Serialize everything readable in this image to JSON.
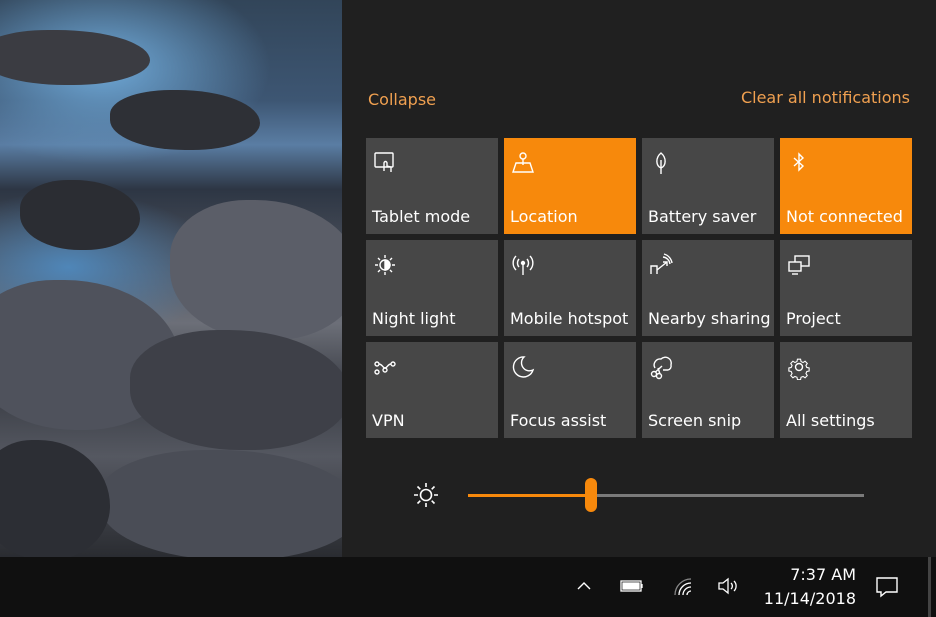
{
  "action_center": {
    "collapse_label": "Collapse",
    "clear_label": "Clear all notifications",
    "accent_color": "#f7890c",
    "tiles": [
      {
        "label": "Tablet mode",
        "icon": "tablet-mode-icon",
        "active": false
      },
      {
        "label": "Location",
        "icon": "location-icon",
        "active": true
      },
      {
        "label": "Battery saver",
        "icon": "battery-saver-icon",
        "active": false
      },
      {
        "label": "Not connected",
        "icon": "bluetooth-icon",
        "active": true
      },
      {
        "label": "Night light",
        "icon": "night-light-icon",
        "active": false
      },
      {
        "label": "Mobile hotspot",
        "icon": "mobile-hotspot-icon",
        "active": false
      },
      {
        "label": "Nearby sharing",
        "icon": "nearby-sharing-icon",
        "active": false
      },
      {
        "label": "Project",
        "icon": "project-icon",
        "active": false
      },
      {
        "label": "VPN",
        "icon": "vpn-icon",
        "active": false
      },
      {
        "label": "Focus assist",
        "icon": "focus-assist-icon",
        "active": false
      },
      {
        "label": "Screen snip",
        "icon": "screen-snip-icon",
        "active": false
      },
      {
        "label": "All settings",
        "icon": "settings-gear-icon",
        "active": false
      }
    ],
    "brightness": {
      "icon": "brightness-icon",
      "percent": 31
    }
  },
  "taskbar": {
    "time": "7:37 AM",
    "date": "11/14/2018",
    "tray_icons": [
      "chevron-up-icon",
      "battery-icon",
      "wifi-icon",
      "volume-icon"
    ],
    "notification_icon": "action-center-icon"
  }
}
